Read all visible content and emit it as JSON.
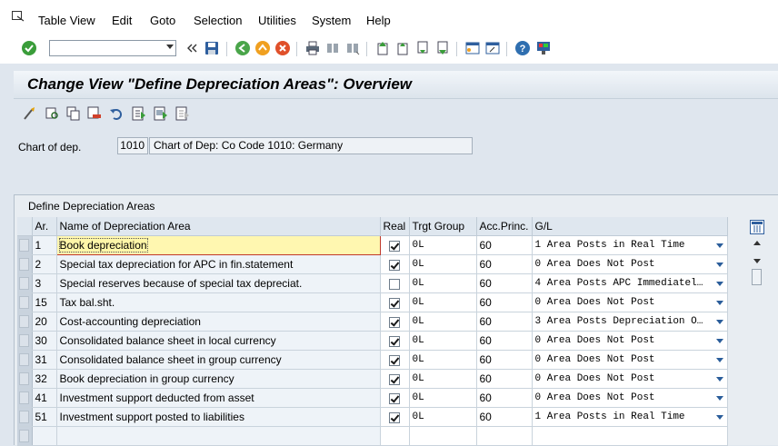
{
  "menu": {
    "items": [
      "Table View",
      "Edit",
      "Goto",
      "Selection",
      "Utilities",
      "System",
      "Help"
    ]
  },
  "toolbar": {
    "command_field_value": "",
    "icons": [
      "enter-icon",
      "back-arrows-icon",
      "save-icon",
      "back-icon",
      "exit-icon",
      "cancel-icon",
      "print-icon",
      "find-icon",
      "find-next-icon",
      "first-page-icon",
      "prev-page-icon",
      "next-page-icon",
      "last-page-icon",
      "new-session-icon",
      "shortcut-icon",
      "help-icon",
      "customize-layout-icon"
    ]
  },
  "title": "Change View \"Define Depreciation Areas\": Overview",
  "app_toolbar": {
    "icons": [
      "display-change-icon",
      "details-icon",
      "copy-icon",
      "delete-icon",
      "undo-icon",
      "select-all-icon",
      "select-block-icon",
      "deselect-all-icon"
    ]
  },
  "chart": {
    "label": "Chart of dep.",
    "code": "1010",
    "description": "Chart of Dep: Co Code 1010: Germany"
  },
  "table": {
    "caption": "Define Depreciation Areas",
    "columns": [
      "Ar.",
      "Name of Depreciation Area",
      "Real",
      "Trgt Group",
      "Acc.Princ.",
      "G/L"
    ],
    "rows": [
      {
        "ar": "1",
        "name": "Book depreciation",
        "real": true,
        "group": "0L",
        "princ": "60",
        "gl": "1 Area Posts in Real Time"
      },
      {
        "ar": "2",
        "name": "Special tax depreciation for APC in fin.statement",
        "real": true,
        "group": "0L",
        "princ": "60",
        "gl": "0 Area Does Not Post"
      },
      {
        "ar": "3",
        "name": "Special reserves because of special tax depreciat.",
        "real": false,
        "group": "0L",
        "princ": "60",
        "gl": "4 Area Posts APC Immediatel…"
      },
      {
        "ar": "15",
        "name": "Tax bal.sht.",
        "real": true,
        "group": "0L",
        "princ": "60",
        "gl": "0 Area Does Not Post"
      },
      {
        "ar": "20",
        "name": "Cost-accounting depreciation",
        "real": true,
        "group": "0L",
        "princ": "60",
        "gl": "3 Area Posts Depreciation O…"
      },
      {
        "ar": "30",
        "name": "Consolidated balance sheet in local currency",
        "real": true,
        "group": "0L",
        "princ": "60",
        "gl": "0 Area Does Not Post"
      },
      {
        "ar": "31",
        "name": "Consolidated balance sheet in group currency",
        "real": true,
        "group": "0L",
        "princ": "60",
        "gl": "0 Area Does Not Post"
      },
      {
        "ar": "32",
        "name": "Book depreciation in group currency",
        "real": true,
        "group": "0L",
        "princ": "60",
        "gl": "0 Area Does Not Post"
      },
      {
        "ar": "41",
        "name": "Investment support deducted from asset",
        "real": true,
        "group": "0L",
        "princ": "60",
        "gl": "0 Area Does Not Post"
      },
      {
        "ar": "51",
        "name": "Investment support posted to liabilities",
        "real": true,
        "group": "0L",
        "princ": "60",
        "gl": "1 Area Posts in Real Time"
      }
    ]
  },
  "colors": {
    "background": "#dfe6ee",
    "focus_cell": "#fff7b0",
    "accent_blue": "#2a5d9a"
  }
}
